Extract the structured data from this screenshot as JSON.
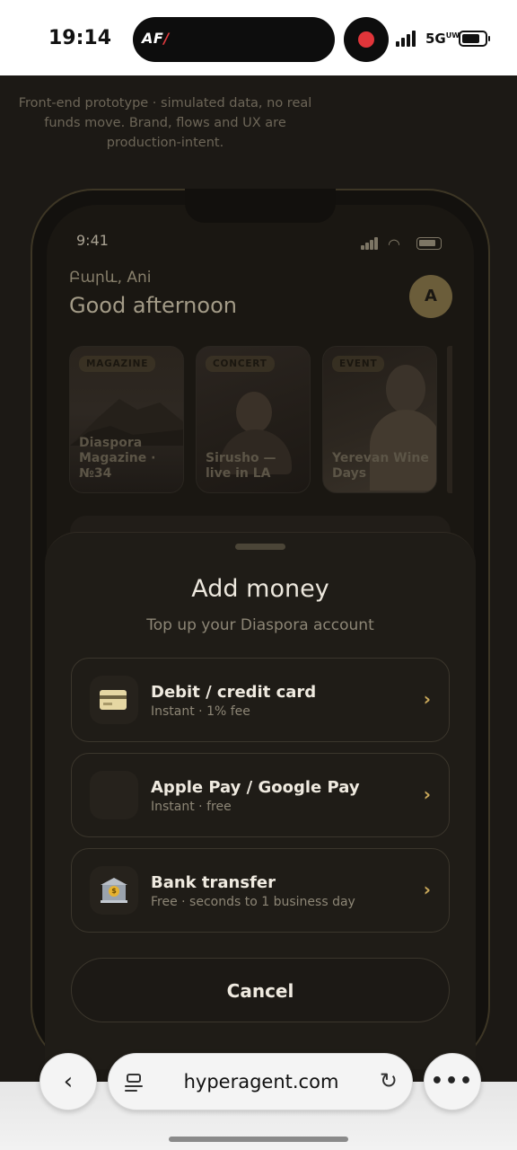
{
  "system_bar": {
    "time": "19:14",
    "island_logo_text": "AF",
    "network": "5G",
    "network_sub": "UW"
  },
  "page": {
    "disclaimer": "Front-end prototype · simulated data, no real funds move. Brand, flows and UX are production-intent."
  },
  "phone": {
    "time": "9:41",
    "greeting_small": "Բարև, Ani",
    "greeting_big": "Good afternoon",
    "avatar_letter": "A",
    "stories": [
      {
        "tag": "MAGAZINE",
        "title": "Diaspora Magazine · №34"
      },
      {
        "tag": "CONCERT",
        "title": "Sirusho — live in LA"
      },
      {
        "tag": "EVENT",
        "title": "Yerevan Wine Days"
      }
    ]
  },
  "sheet": {
    "title": "Add money",
    "subtitle": "Top up your Diaspora account",
    "options": [
      {
        "label": "Debit / credit card",
        "detail": "Instant · 1% fee",
        "icon": "credit-card-icon"
      },
      {
        "label": "Apple Pay / Google Pay",
        "detail": "Instant · free",
        "icon": "wallet-icon"
      },
      {
        "label": "Bank transfer",
        "detail": "Free · seconds to 1 business day",
        "icon": "bank-icon"
      }
    ],
    "chevron": "›",
    "cancel_label": "Cancel"
  },
  "browser": {
    "url": "hyperagent.com",
    "back_glyph": "‹",
    "more_glyph": "•••",
    "reload_glyph": "↻"
  },
  "colors": {
    "accent_gold": "#c9a85a",
    "sheet_background": "#1f1c17",
    "record_red": "#e1353a"
  }
}
